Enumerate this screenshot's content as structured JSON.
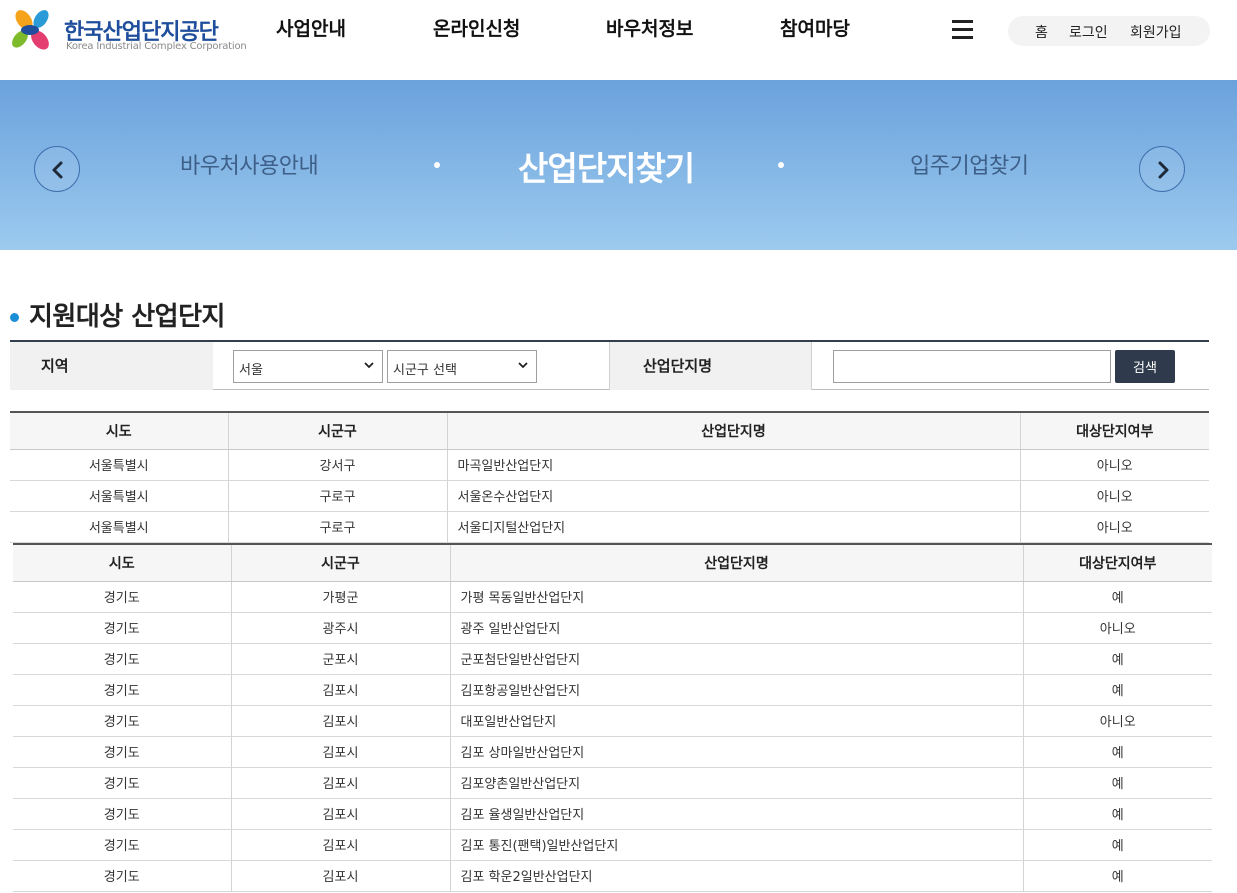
{
  "header": {
    "logo": {
      "title": "한국산업단지공단",
      "subtitle": "Korea Industrial Complex Corporation"
    },
    "nav": [
      "사업안내",
      "온라인신청",
      "바우처정보",
      "참여마당"
    ],
    "util": [
      "홈",
      "로그인",
      "회원가입"
    ]
  },
  "banner": {
    "prev_label": "바우처사용안내",
    "active_label": "산업단지찾기",
    "next_label": "입주기업찾기"
  },
  "section": {
    "title": "지원대상 산업단지"
  },
  "search": {
    "region_label": "지역",
    "region_value": "서울",
    "district_value": "시군구 선택",
    "name_label": "산업단지명",
    "name_value": "",
    "button_label": "검색"
  },
  "columns": [
    "시도",
    "시군구",
    "산업단지명",
    "대상단지여부"
  ],
  "table1": [
    [
      "서울특별시",
      "강서구",
      "마곡일반산업단지",
      "아니오"
    ],
    [
      "서울특별시",
      "구로구",
      "서울온수산업단지",
      "아니오"
    ],
    [
      "서울특별시",
      "구로구",
      "서울디지털산업단지",
      "아니오"
    ]
  ],
  "table2": [
    [
      "경기도",
      "가평군",
      "가평 목동일반산업단지",
      "예"
    ],
    [
      "경기도",
      "광주시",
      "광주 일반산업단지",
      "아니오"
    ],
    [
      "경기도",
      "군포시",
      "군포첨단일반산업단지",
      "예"
    ],
    [
      "경기도",
      "김포시",
      "김포항공일반산업단지",
      "예"
    ],
    [
      "경기도",
      "김포시",
      "대포일반산업단지",
      "아니오"
    ],
    [
      "경기도",
      "김포시",
      "김포 상마일반산업단지",
      "예"
    ],
    [
      "경기도",
      "김포시",
      "김포양촌일반산업단지",
      "예"
    ],
    [
      "경기도",
      "김포시",
      "김포 율생일반산업단지",
      "예"
    ],
    [
      "경기도",
      "김포시",
      "김포 통진(팬택)일반산업단지",
      "예"
    ],
    [
      "경기도",
      "김포시",
      "김포 학운2일반산업단지",
      "예"
    ]
  ]
}
